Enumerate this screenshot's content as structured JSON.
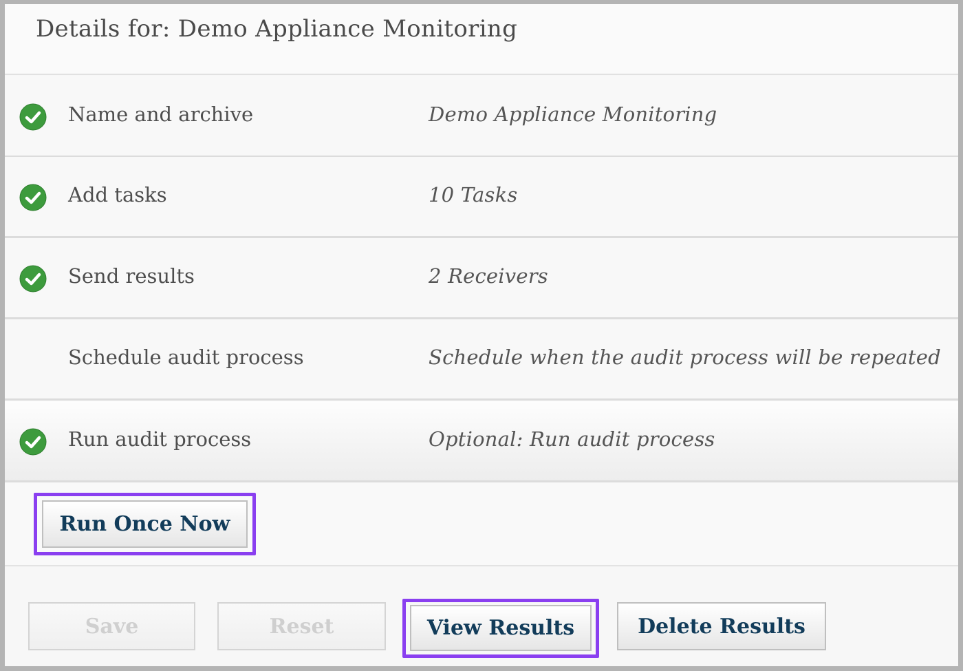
{
  "header": {
    "title": "Details for: Demo Appliance Monitoring"
  },
  "steps": [
    {
      "label": "Name and archive",
      "value": "Demo Appliance Monitoring",
      "completed": true,
      "icon": "check-circle-icon"
    },
    {
      "label": "Add tasks",
      "value": "10 Tasks",
      "completed": true,
      "icon": "check-circle-icon"
    },
    {
      "label": "Send results",
      "value": "2 Receivers",
      "completed": true,
      "icon": "check-circle-icon"
    },
    {
      "label": "Schedule audit process",
      "value": "Schedule when the audit process will be repeated",
      "completed": false
    },
    {
      "label": "Run audit process",
      "value": "Optional: Run audit process",
      "completed": true,
      "icon": "check-circle-icon"
    }
  ],
  "actions": {
    "run_once_label": "Run Once Now"
  },
  "footer": {
    "save_label": "Save",
    "reset_label": "Reset",
    "view_results_label": "View Results",
    "delete_results_label": "Delete Results"
  },
  "colors": {
    "check_green": "#3d9b3d",
    "highlight_purple": "#8a3ff0",
    "button_text": "#123c5a",
    "disabled_text": "#cfcfcf"
  }
}
